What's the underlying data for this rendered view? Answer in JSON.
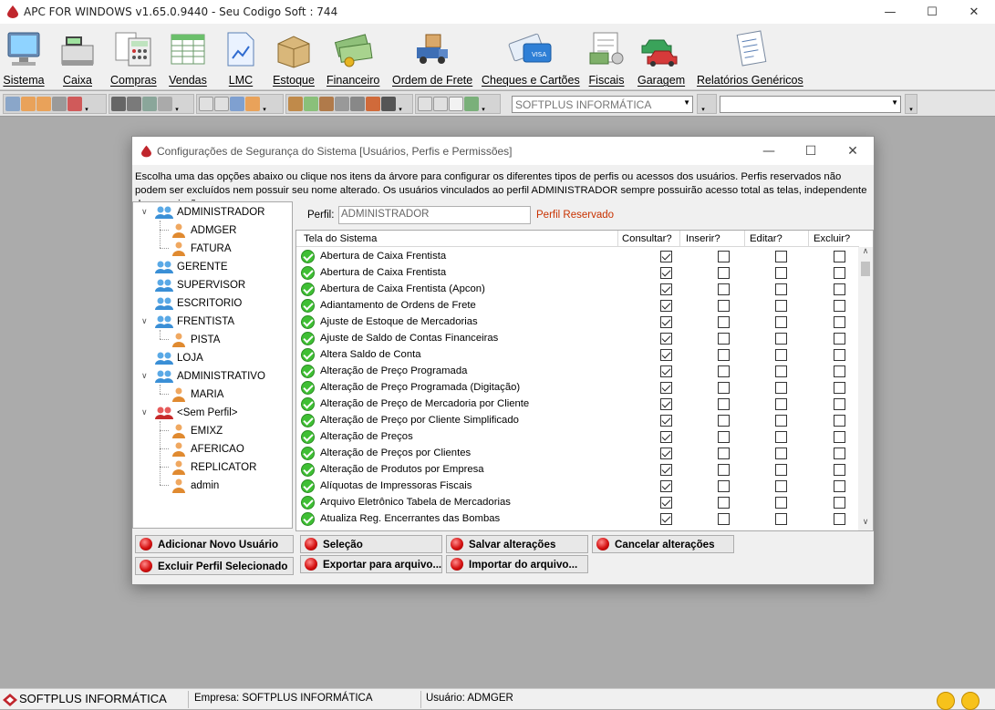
{
  "app": {
    "title": "APC FOR WINDOWS v1.65.0.9440 - Seu Codigo Soft : 744",
    "window_controls": {
      "minimize": "—",
      "maximize": "☐",
      "close": "✕"
    }
  },
  "menu": [
    {
      "label": "Sistema",
      "icon": "computer-icon"
    },
    {
      "label": "Caixa",
      "icon": "cash-register-icon"
    },
    {
      "label": "Compras",
      "icon": "calculator-icon"
    },
    {
      "label": "Vendas",
      "icon": "spreadsheet-icon"
    },
    {
      "label": "LMC",
      "icon": "document-chart-icon"
    },
    {
      "label": "Estoque",
      "icon": "box-icon"
    },
    {
      "label": "Financeiro",
      "icon": "money-icon"
    },
    {
      "label": "Ordem de Frete",
      "icon": "truck-icon"
    },
    {
      "label": "Cheques e Cartões",
      "icon": "credit-card-icon"
    },
    {
      "label": "Fiscais",
      "icon": "receipt-icon"
    },
    {
      "label": "Garagem",
      "icon": "cars-icon"
    },
    {
      "label": "Relatórios Genéricos",
      "icon": "report-icon"
    }
  ],
  "toolbar": {
    "company_combo": "SOFTPLUS INFORMÁTICA",
    "second_combo": ""
  },
  "dialog": {
    "title": "Configurações de Segurança do Sistema [Usuários, Perfis e Permissões]",
    "description": "Escolha uma das opções abaixo ou clique nos itens da árvore para configurar os diferentes tipos de perfis ou acessos dos usuários. Perfis reservados não podem ser excluídos nem possuir seu nome alterado. Os usuários vinculados ao perfil ADMINISTRADOR sempre possuirão acesso total as telas, independente das permissões.",
    "tree": [
      {
        "label": "ADMINISTRADOR",
        "type": "group",
        "expanded": true
      },
      {
        "label": "ADMGER",
        "type": "user"
      },
      {
        "label": "FATURA",
        "type": "user"
      },
      {
        "label": "GERENTE",
        "type": "group"
      },
      {
        "label": "SUPERVISOR",
        "type": "group"
      },
      {
        "label": "ESCRITORIO",
        "type": "group"
      },
      {
        "label": "FRENTISTA",
        "type": "group",
        "expanded": true
      },
      {
        "label": "PISTA",
        "type": "user"
      },
      {
        "label": "LOJA",
        "type": "group"
      },
      {
        "label": "ADMINISTRATIVO",
        "type": "group",
        "expanded": true
      },
      {
        "label": "MARIA",
        "type": "user"
      },
      {
        "label": "<Sem Perfil>",
        "type": "noprofile",
        "expanded": true
      },
      {
        "label": "EMIXZ",
        "type": "user"
      },
      {
        "label": "AFERICAO",
        "type": "user"
      },
      {
        "label": "REPLICATOR",
        "type": "user"
      },
      {
        "label": "admin",
        "type": "user"
      }
    ],
    "perfil_label": "Perfil:",
    "perfil_value": "ADMINISTRADOR",
    "perfil_reserved": "Perfil Reservado",
    "columns": [
      "Tela do Sistema",
      "Consultar?",
      "Inserir?",
      "Editar?",
      "Excluir?"
    ],
    "rows": [
      {
        "name": "Abertura de Caixa Frentista",
        "consultar": true,
        "inserir": false,
        "editar": false,
        "excluir": false
      },
      {
        "name": "Abertura de Caixa Frentista",
        "consultar": true,
        "inserir": false,
        "editar": false,
        "excluir": false
      },
      {
        "name": "Abertura de Caixa Frentista (Apcon)",
        "consultar": true,
        "inserir": false,
        "editar": false,
        "excluir": false
      },
      {
        "name": "Adiantamento de Ordens de Frete",
        "consultar": true,
        "inserir": false,
        "editar": false,
        "excluir": false
      },
      {
        "name": "Ajuste de Estoque de Mercadorias",
        "consultar": true,
        "inserir": false,
        "editar": false,
        "excluir": false
      },
      {
        "name": "Ajuste de Saldo de Contas Financeiras",
        "consultar": true,
        "inserir": false,
        "editar": false,
        "excluir": false
      },
      {
        "name": "Altera Saldo de Conta",
        "consultar": true,
        "inserir": false,
        "editar": false,
        "excluir": false
      },
      {
        "name": "Alteração de Preço Programada",
        "consultar": true,
        "inserir": false,
        "editar": false,
        "excluir": false
      },
      {
        "name": "Alteração de Preço Programada (Digitação)",
        "consultar": true,
        "inserir": false,
        "editar": false,
        "excluir": false
      },
      {
        "name": "Alteração de Preço de Mercadoria por Cliente",
        "consultar": true,
        "inserir": false,
        "editar": false,
        "excluir": false
      },
      {
        "name": "Alteração de Preço por Cliente Simplificado",
        "consultar": true,
        "inserir": false,
        "editar": false,
        "excluir": false
      },
      {
        "name": "Alteração de Preços",
        "consultar": true,
        "inserir": false,
        "editar": false,
        "excluir": false
      },
      {
        "name": "Alteração de Preços por Clientes",
        "consultar": true,
        "inserir": false,
        "editar": false,
        "excluir": false
      },
      {
        "name": "Alteração de Produtos por Empresa",
        "consultar": true,
        "inserir": false,
        "editar": false,
        "excluir": false
      },
      {
        "name": "Alíquotas de Impressoras Fiscais",
        "consultar": true,
        "inserir": false,
        "editar": false,
        "excluir": false
      },
      {
        "name": "Arquivo Eletrônico Tabela de Mercadorias",
        "consultar": true,
        "inserir": false,
        "editar": false,
        "excluir": false
      },
      {
        "name": "Atualiza Reg. Encerrantes das Bombas",
        "consultar": true,
        "inserir": false,
        "editar": false,
        "excluir": false
      }
    ],
    "buttons": {
      "add_user": "Adicionar Novo Usuário",
      "delete_profile": "Excluir Perfil Selecionado",
      "selection": "Seleção",
      "save": "Salvar alterações",
      "cancel": "Cancelar alterações",
      "export": "Exportar para arquivo...",
      "import": "Importar do arquivo..."
    }
  },
  "statusbar": {
    "brand": "SOFTPLUS INFORMÁTICA",
    "empresa": "Empresa: SOFTPLUS INFORMÁTICA",
    "usuario": "Usuário: ADMGER"
  }
}
